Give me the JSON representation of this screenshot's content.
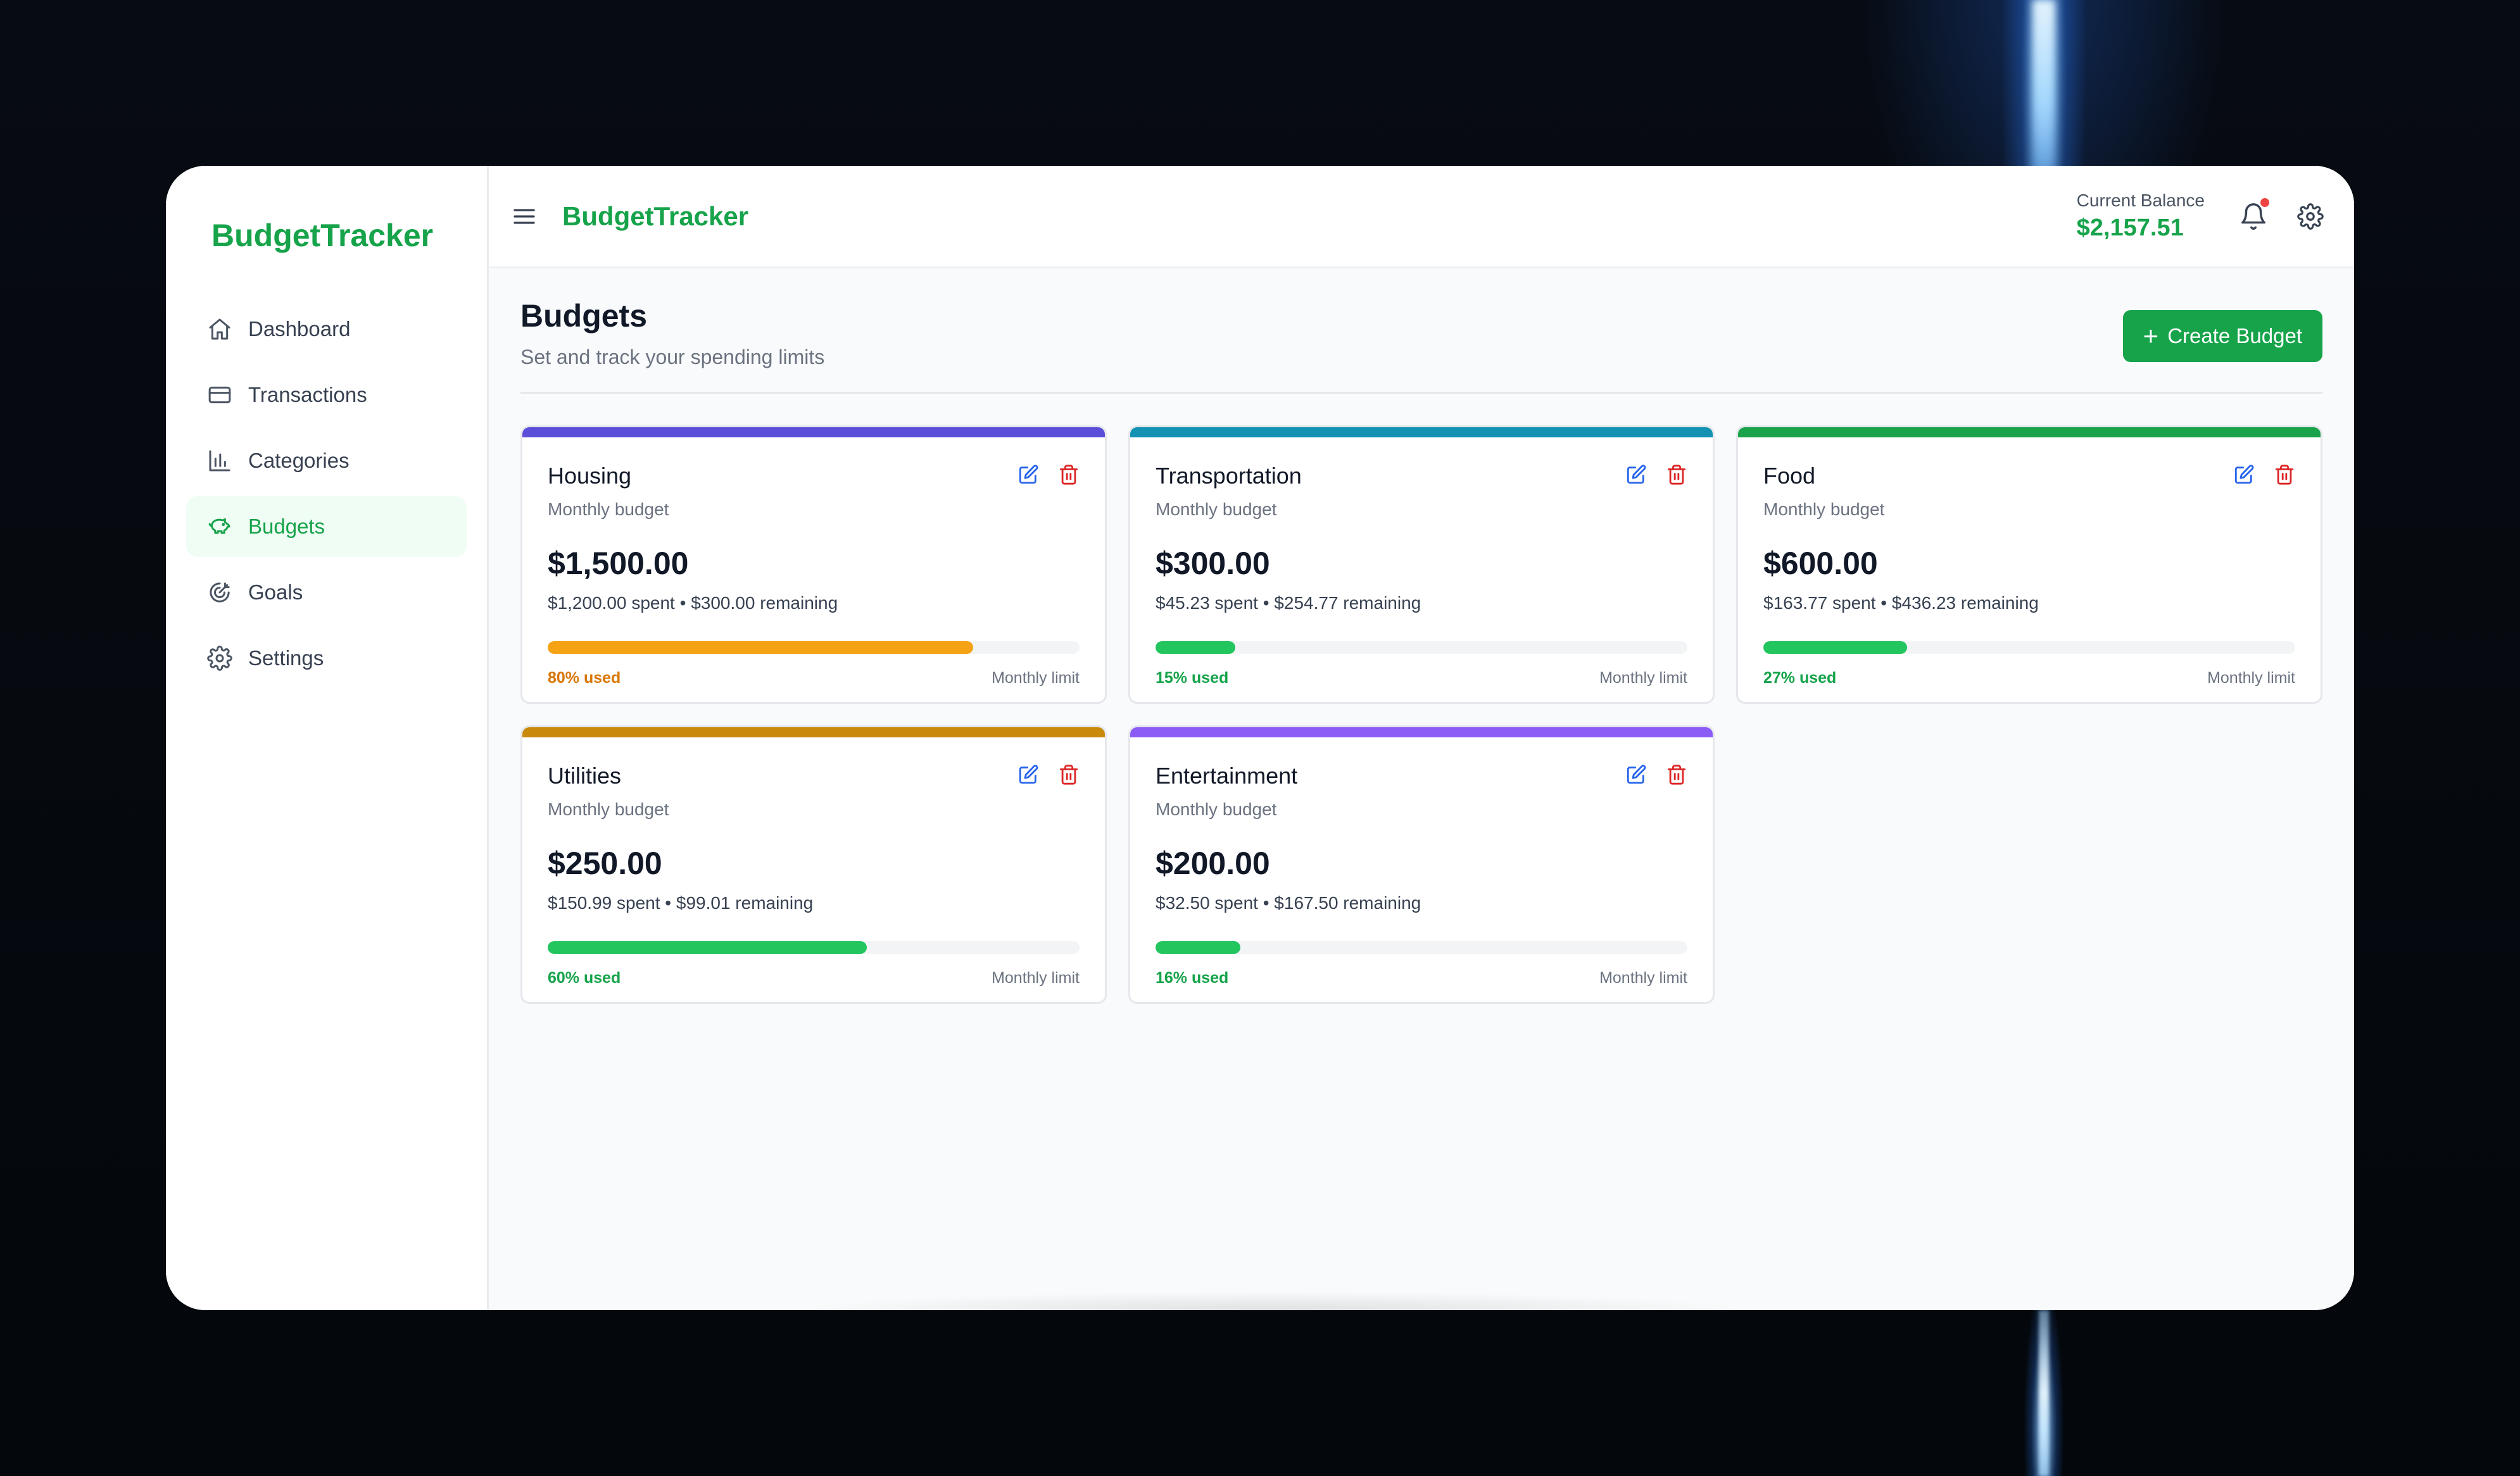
{
  "sidebar": {
    "brand": "BudgetTracker",
    "items": [
      {
        "label": "Dashboard",
        "icon": "home-icon"
      },
      {
        "label": "Transactions",
        "icon": "credit-card-icon"
      },
      {
        "label": "Categories",
        "icon": "bar-chart-icon"
      },
      {
        "label": "Budgets",
        "icon": "piggy-bank-icon",
        "active": true
      },
      {
        "label": "Goals",
        "icon": "target-icon"
      },
      {
        "label": "Settings",
        "icon": "gear-icon"
      }
    ]
  },
  "topbar": {
    "brand": "BudgetTracker",
    "balance_label": "Current Balance",
    "balance_value": "$2,157.51"
  },
  "page": {
    "title": "Budgets",
    "subtitle": "Set and track your spending limits",
    "create_button": "Create Budget"
  },
  "budgets": [
    {
      "name": "Housing",
      "period": "Monthly budget",
      "amount": "$1,500.00",
      "spent": "$1,200.00 spent",
      "remaining": "$300.00 remaining",
      "used_label": "80% used",
      "used_fraction": 0.8,
      "limit_label": "Monthly limit",
      "accent": "#5b4fd9",
      "fill": "#f5a314",
      "used_color": "#d97706"
    },
    {
      "name": "Transportation",
      "period": "Monthly budget",
      "amount": "$300.00",
      "spent": "$45.23 spent",
      "remaining": "$254.77 remaining",
      "used_label": "15% used",
      "used_fraction": 0.15,
      "limit_label": "Monthly limit",
      "accent": "#1392b3",
      "fill": "#22c55e",
      "used_color": "#16a34a"
    },
    {
      "name": "Food",
      "period": "Monthly budget",
      "amount": "$600.00",
      "spent": "$163.77 spent",
      "remaining": "$436.23 remaining",
      "used_label": "27% used",
      "used_fraction": 0.27,
      "limit_label": "Monthly limit",
      "accent": "#1aa34a",
      "fill": "#22c55e",
      "used_color": "#16a34a"
    },
    {
      "name": "Utilities",
      "period": "Monthly budget",
      "amount": "$250.00",
      "spent": "$150.99 spent",
      "remaining": "$99.01 remaining",
      "used_label": "60% used",
      "used_fraction": 0.6,
      "limit_label": "Monthly limit",
      "accent": "#c98a0b",
      "fill": "#22c55e",
      "used_color": "#16a34a"
    },
    {
      "name": "Entertainment",
      "period": "Monthly budget",
      "amount": "$200.00",
      "spent": "$32.50 spent",
      "remaining": "$167.50 remaining",
      "used_label": "16% used",
      "used_fraction": 0.16,
      "limit_label": "Monthly limit",
      "accent": "#8b5cf6",
      "fill": "#22c55e",
      "used_color": "#16a34a"
    }
  ],
  "colors": {
    "brand": "#16a34a",
    "edit_icon": "#2563eb",
    "delete_icon": "#dc2626",
    "notification_dot": "#ef4444"
  }
}
